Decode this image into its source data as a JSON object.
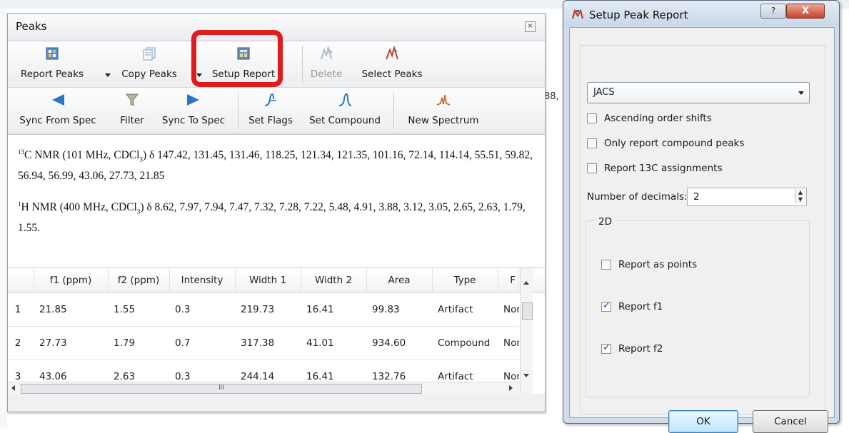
{
  "background": {
    "partial_number": "88,"
  },
  "peaks": {
    "title": "Peaks",
    "close_glyph": "×",
    "toolbar1": {
      "report_peaks": "Report Peaks",
      "copy_peaks": "Copy Peaks",
      "setup_report": "Setup Report",
      "delete": "Delete",
      "select_peaks": "Select Peaks"
    },
    "toolbar2": {
      "sync_from_spec": "Sync From Spec",
      "filter": "Filter",
      "sync_to_spec": "Sync To Spec",
      "set_flags": "Set Flags",
      "set_compound": "Set Compound",
      "new_spectrum": "New Spectrum"
    },
    "report": {
      "c13_sup": "13",
      "c13_nucleus": "C NMR (101 MHz, CDCl",
      "c13_sub": "3",
      "c13_rest": ") δ 147.42, 131.45, 131.46, 118.25, 121.34, 121.35, 101.16, 72.14, 114.14, 55.51, 59.82, 56.94, 56.99, 43.06, 27.73, 21.85",
      "h1_sup": "1",
      "h1_nucleus": "H NMR (400 MHz, CDCl",
      "h1_sub": "3",
      "h1_rest": ") δ 8.62, 7.97, 7.94, 7.47, 7.32, 7.28, 7.22, 5.48, 4.91, 3.88, 3.12, 3.05, 2.65, 2.63, 1.79, 1.55."
    },
    "table": {
      "columns": [
        "f1 (ppm)",
        "f2 (ppm)",
        "Intensity",
        "Width 1",
        "Width 2",
        "Area",
        "Type",
        "F"
      ],
      "rows": [
        {
          "num": "1",
          "f1": "21.85",
          "f2": "1.55",
          "intensity": "0.3",
          "width1": "219.73",
          "width2": "16.41",
          "area": "99.83",
          "type": "Artifact",
          "flag": "Nor"
        },
        {
          "num": "2",
          "f1": "27.73",
          "f2": "1.79",
          "intensity": "0.7",
          "width1": "317.38",
          "width2": "41.01",
          "area": "934.60",
          "type": "Compound",
          "flag": "Nor"
        },
        {
          "num": "3",
          "f1": "43.06",
          "f2": "2.63",
          "intensity": "0.3",
          "width1": "244.14",
          "width2": "16.41",
          "area": "132.76",
          "type": "Artifact",
          "flag": "Nor"
        }
      ],
      "hscroll_grip": "III"
    }
  },
  "dialog": {
    "title": "Setup Peak Report",
    "help_glyph": "?",
    "close_glyph": "X",
    "format_value": "JACS",
    "ascending_order": "Ascending order shifts",
    "only_compound": "Only report compound peaks",
    "report_13c": "Report 13C assignments",
    "decimals_label": "Number of decimals:",
    "decimals_value": "2",
    "group_2d": "2D",
    "report_points": "Report as points",
    "report_f1": "Report f1",
    "report_f2": "Report f2",
    "ok": "OK",
    "cancel": "Cancel",
    "checked": {
      "ascending": false,
      "only_compound": false,
      "report_13c": false,
      "points": false,
      "f1": true,
      "f2": true
    }
  },
  "colors": {
    "highlight": "#e01b1b",
    "dialog_frame": "#cfdceb",
    "ok_accent": "#3c7fb1"
  }
}
